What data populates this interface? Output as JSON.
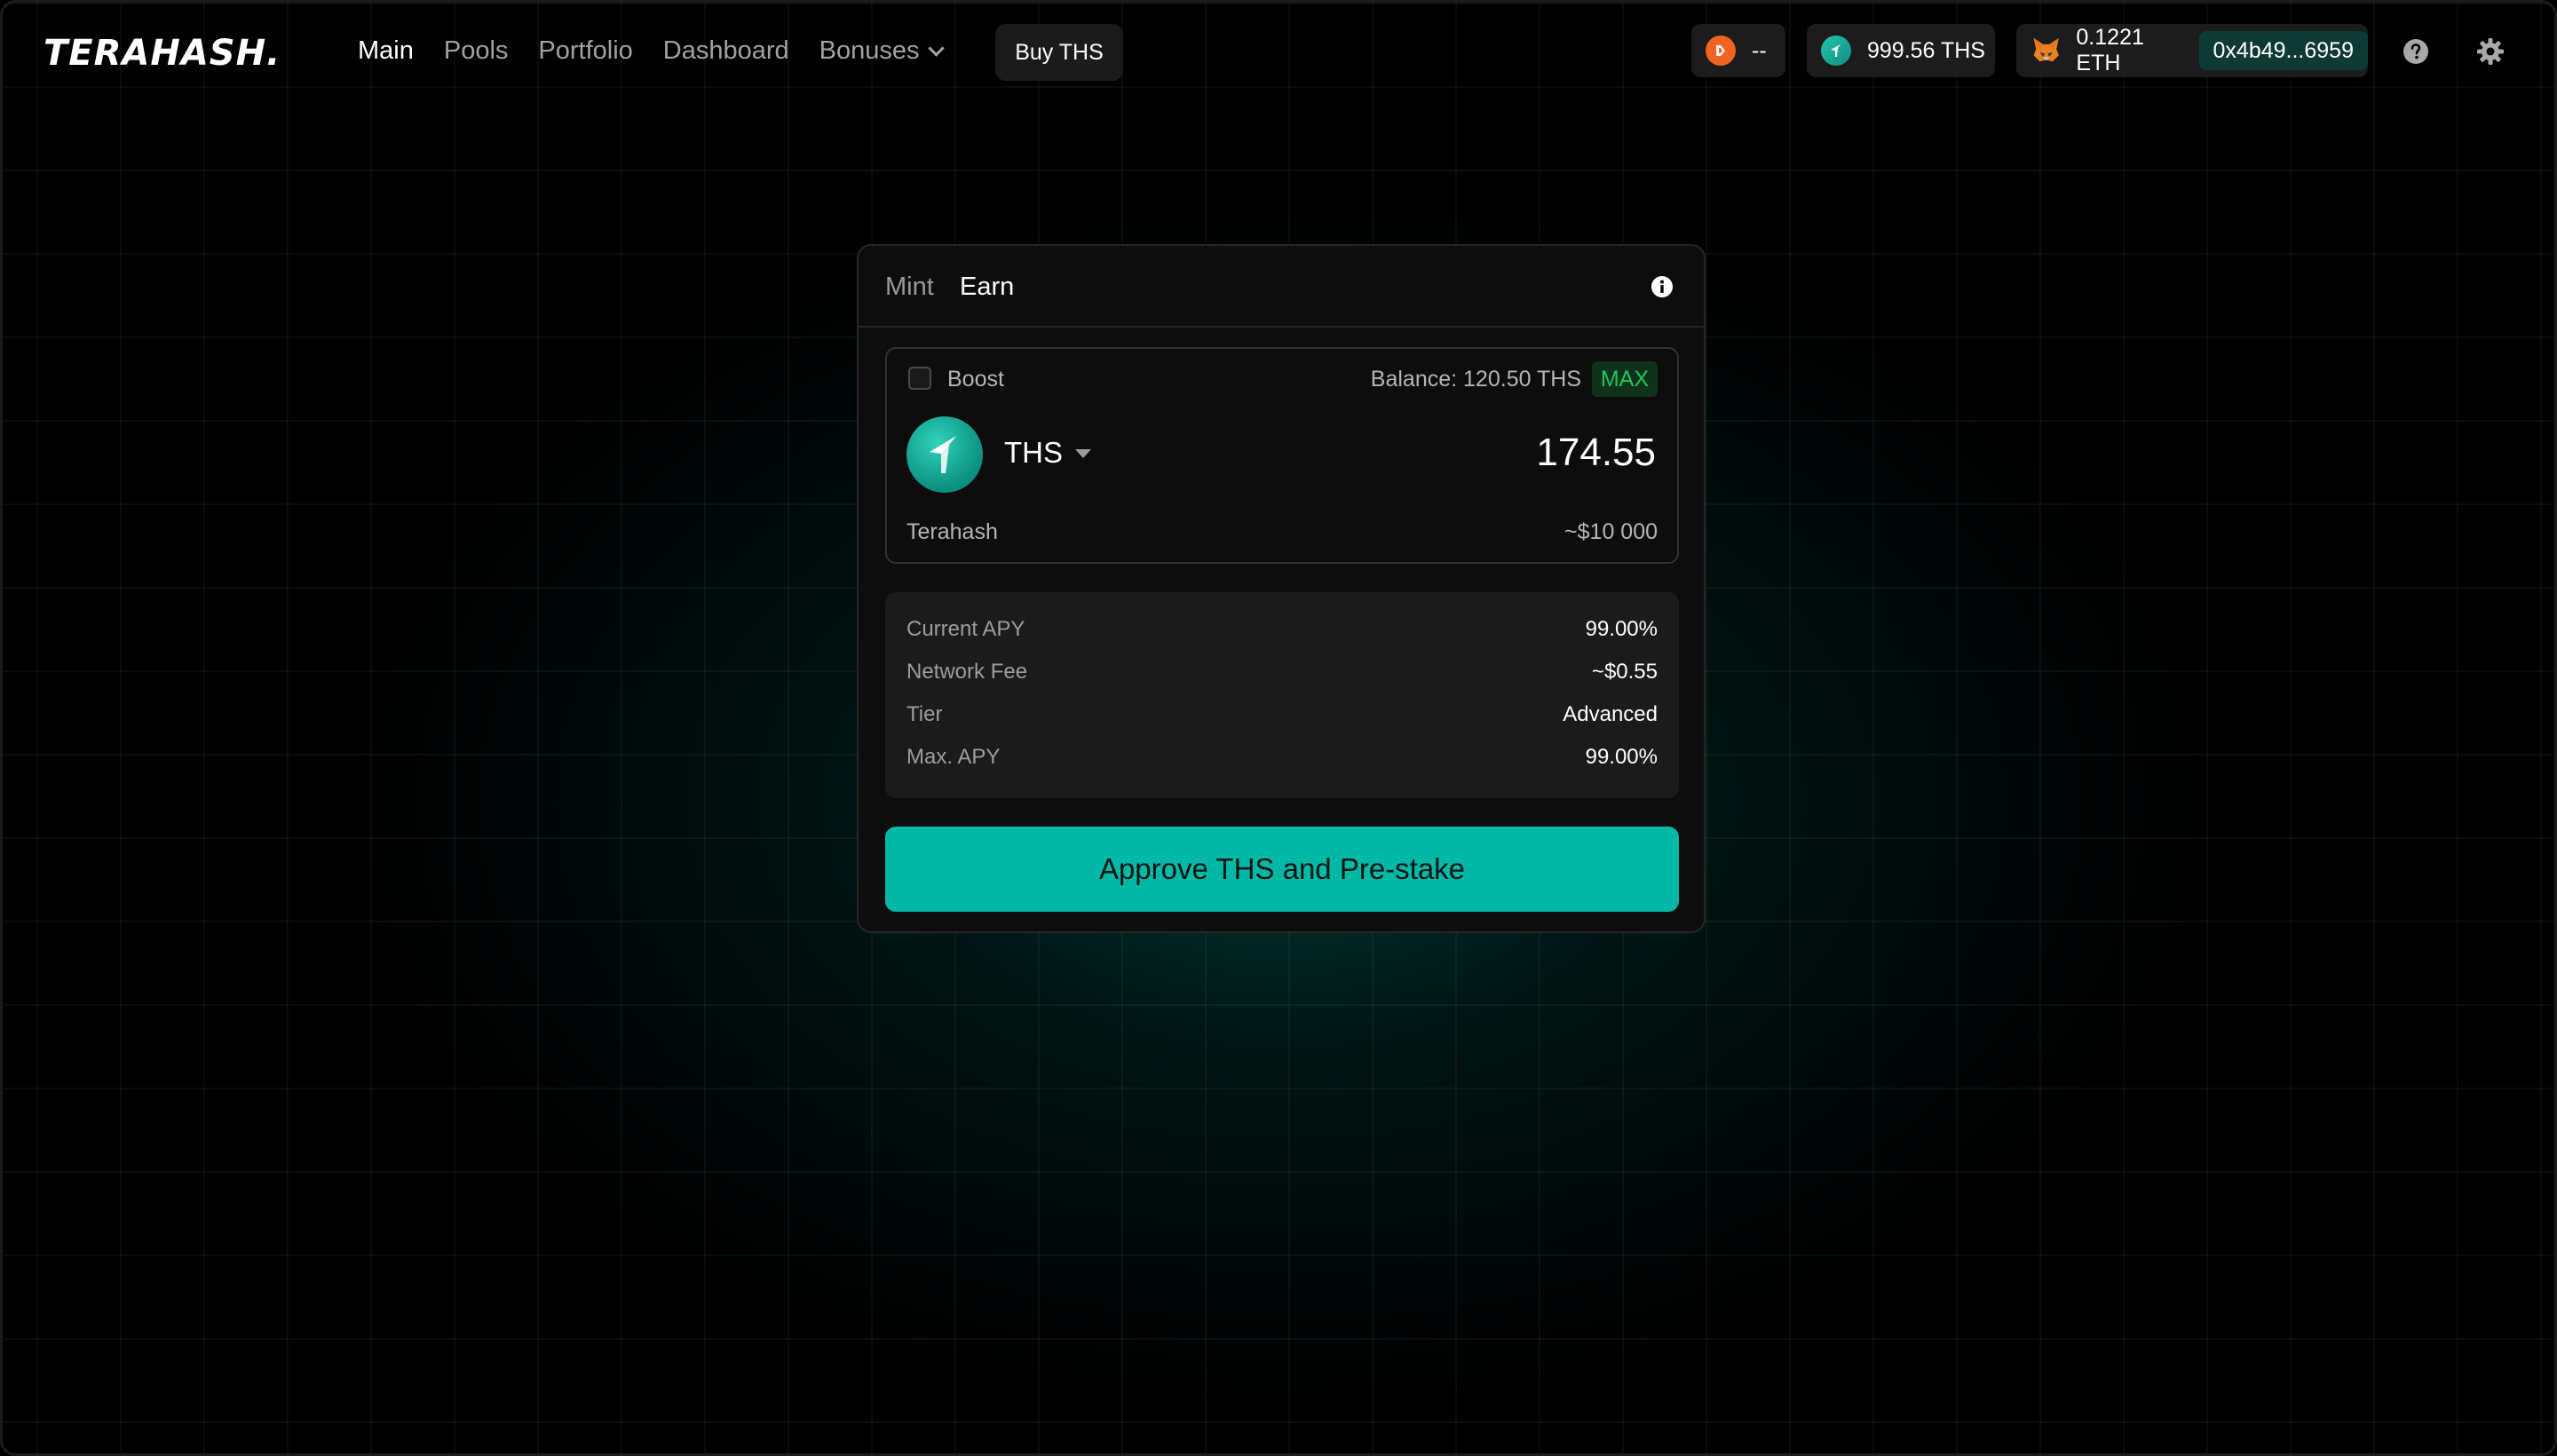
{
  "header": {
    "logo": "TERAHASH.",
    "nav": [
      "Main",
      "Pools",
      "Portfolio",
      "Dashboard",
      "Bonuses"
    ],
    "active_nav": "Main",
    "buy_label": "Buy THS",
    "points_value": "--",
    "ths_balance": "999.56 THS",
    "eth_balance": "0.1221 ETH",
    "wallet_address": "0x4b49...6959",
    "icons": {
      "points": "points-coin-icon",
      "ths": "ths-coin-icon",
      "wallet": "metamask-fox-icon",
      "help": "help-icon",
      "settings": "gear-icon"
    }
  },
  "card": {
    "tabs": [
      "Mint",
      "Earn"
    ],
    "active_tab": "Earn",
    "boost_label": "Boost",
    "boost_checked": false,
    "balance_label": "Balance: 120.50 THS",
    "max_label": "MAX",
    "token_symbol": "THS",
    "token_name": "Terahash",
    "amount": "174.55",
    "usd_value": "~$10 000",
    "stats": [
      {
        "label": "Current APY",
        "value": "99.00%"
      },
      {
        "label": "Network Fee",
        "value": "~$0.55"
      },
      {
        "label": "Tier",
        "value": "Advanced"
      },
      {
        "label": "Max. APY",
        "value": "99.00%"
      }
    ],
    "action_label": "Approve THS and Pre-stake"
  },
  "colors": {
    "accent": "#00b8a6",
    "max_green": "#22c55e",
    "points_orange": "#f06320",
    "address_bg": "#0d3a34"
  }
}
